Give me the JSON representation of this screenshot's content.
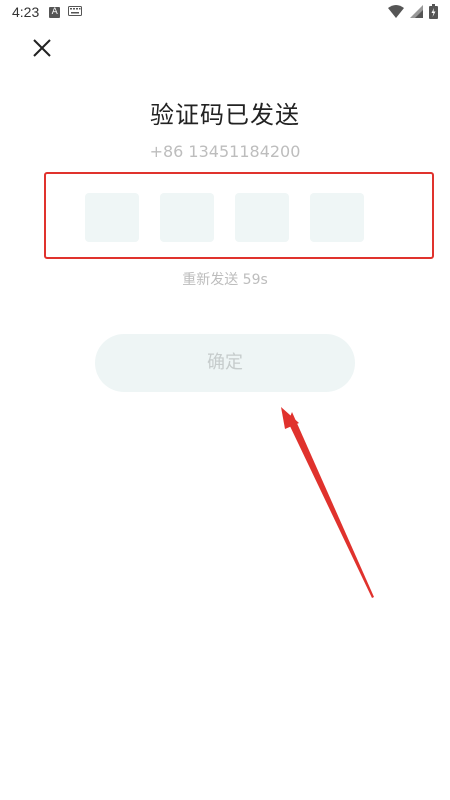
{
  "status_bar": {
    "time": "4:23",
    "icons": [
      "notification-a-icon",
      "keyboard-icon",
      "wifi-icon",
      "signal-icon",
      "battery-icon"
    ]
  },
  "close_icon": "close-icon",
  "title": "验证码已发送",
  "phone": "+86 13451184200",
  "code_boxes": [
    "",
    "",
    "",
    ""
  ],
  "resend_text": "重新发送 59s",
  "confirm_label": "确定",
  "colors": {
    "annotation_red": "#e0322d",
    "box_fill": "#eff6f6",
    "button_fill": "#eef5f5",
    "muted_text": "#bdbdbd"
  }
}
